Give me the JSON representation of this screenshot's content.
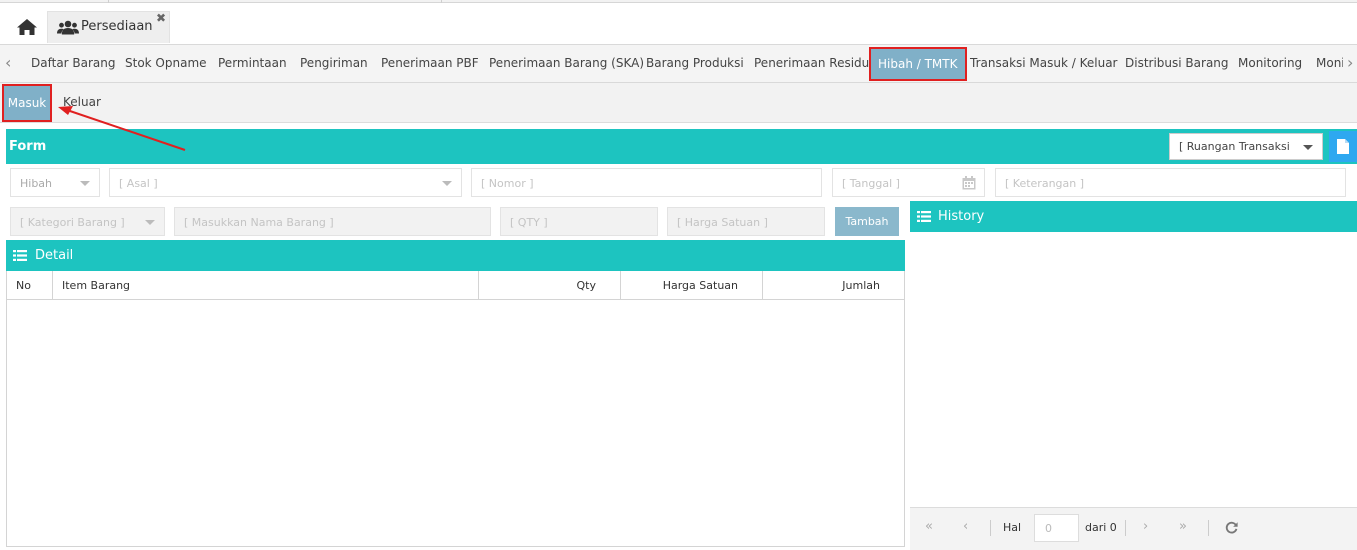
{
  "app_tab": {
    "label": "Persediaan"
  },
  "menu": {
    "items": [
      "Daftar Barang",
      "Stok Opname",
      "Permintaan",
      "Pengiriman",
      "Penerimaan PBF",
      "Penerimaan Barang (SKA)",
      "Barang Produksi",
      "Penerimaan Residu",
      "Hibah / TMTK",
      "Transaksi Masuk / Keluar",
      "Distribusi Barang",
      "Monitoring",
      "Moni"
    ],
    "active": "Hibah / TMTK"
  },
  "submenu": {
    "items": [
      "Masuk",
      "Keluar"
    ],
    "active": "Masuk"
  },
  "form": {
    "title": "Form",
    "ruangan_placeholder": "[ Ruangan Transaksi",
    "jenis_value": "Hibah",
    "asal_placeholder": "[ Asal ]",
    "nomor_placeholder": "[ Nomor ]",
    "tanggal_placeholder": "[ Tanggal ]",
    "keterangan_placeholder": "[ Keterangan ]",
    "kategori_placeholder": "[ Kategori Barang ]",
    "nama_barang_placeholder": "[ Masukkan Nama Barang ]",
    "qty_placeholder": "[ QTY ]",
    "harga_placeholder": "[ Harga Satuan ]",
    "tambah_label": "Tambah"
  },
  "detail": {
    "title": "Detail",
    "columns": [
      "No",
      "Item Barang",
      "Qty",
      "Harga Satuan",
      "Jumlah"
    ]
  },
  "history": {
    "title": "History"
  },
  "pager": {
    "hal_label": "Hal",
    "page_value": "0",
    "of_label": "dari 0"
  },
  "colors": {
    "teal": "#1dc4c0",
    "active_tab": "#80b0c8",
    "highlight": "#e02020",
    "doc_button": "#2ea8f0"
  }
}
